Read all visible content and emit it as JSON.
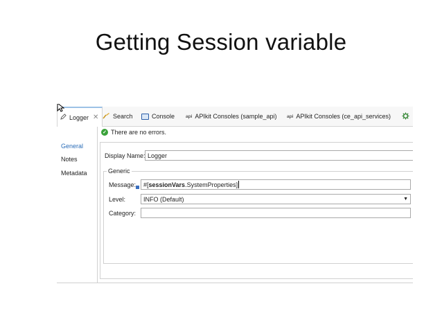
{
  "slide": {
    "title": "Getting Session variable"
  },
  "tabs": [
    {
      "label": "Logger",
      "icon": "pencil-icon",
      "active": true,
      "closable": true
    },
    {
      "label": "Search",
      "icon": "search-icon"
    },
    {
      "label": "Console",
      "icon": "console-icon"
    },
    {
      "label": "APIkit Consoles (sample_api)",
      "prefix": "api"
    },
    {
      "label": "APIkit Consoles (ce_api_services)",
      "prefix": "api"
    },
    {
      "label": "",
      "icon": "gear-icon"
    }
  ],
  "nav": {
    "items": [
      "General",
      "Notes",
      "Metadata"
    ],
    "selected": "General"
  },
  "status": {
    "text": "There are no errors.",
    "icon": "check-circle-icon"
  },
  "form": {
    "display_name_label": "Display Name:",
    "display_name_value": "Logger",
    "group_label": "Generic",
    "message_label": "Message:",
    "message_prefix": "#[",
    "message_var": "sessionVars",
    "message_suffix": ".SystemProperties]",
    "level_label": "Level:",
    "level_value": "INFO (Default)",
    "category_label": "Category:",
    "category_value": ""
  },
  "colors": {
    "accent_blue": "#2a6db8",
    "ok_green": "#3aa23a",
    "tab_highlight": "#9cc1e6"
  }
}
